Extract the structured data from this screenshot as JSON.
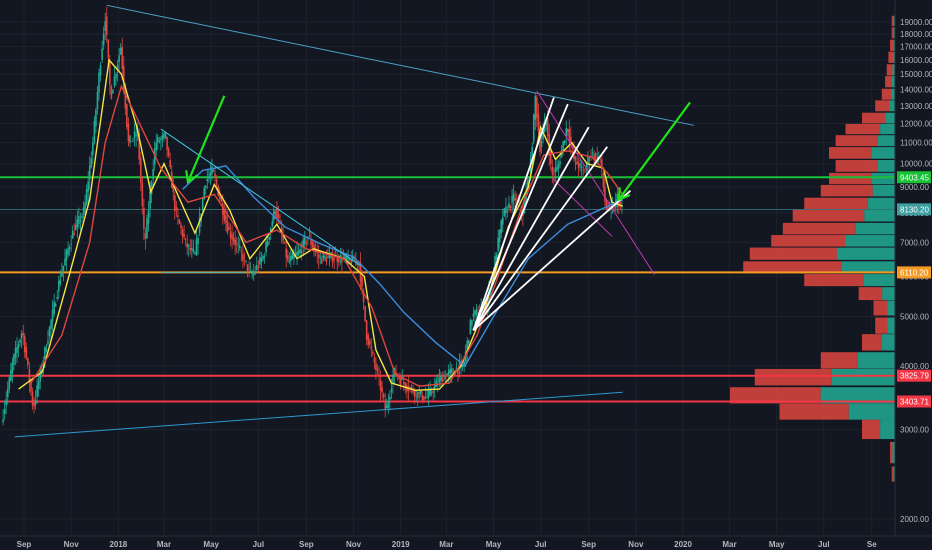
{
  "chart_data": {
    "type": "candlestick",
    "y_axis": {
      "scale": "log",
      "range": [
        1850,
        21000
      ],
      "ticks": [
        2000,
        3000,
        4000,
        5000,
        6000,
        7000,
        8000,
        9000,
        10000,
        11000,
        12000,
        13000,
        14000,
        15000,
        16000,
        17000,
        18000,
        19000
      ],
      "tick_labels": [
        "2000.00",
        "3000.00",
        "4000.00",
        "5000.00",
        "6000.00",
        "7000.00",
        "8000.00",
        "9000.00",
        "10000.00",
        "11000.00",
        "12000.00",
        "13000.00",
        "14000.00",
        "15000.00",
        "16000.00",
        "17000.00",
        "18000.00",
        "19000.00"
      ]
    },
    "x_axis": {
      "range": [
        "2017-08-01",
        "2020-10-01"
      ],
      "ticks": [
        {
          "date": "2017-09-01",
          "label": "Sep"
        },
        {
          "date": "2017-11-01",
          "label": "Nov"
        },
        {
          "date": "2018-01-01",
          "label": "2018"
        },
        {
          "date": "2018-03-01",
          "label": "Mar"
        },
        {
          "date": "2018-05-01",
          "label": "May"
        },
        {
          "date": "2018-07-01",
          "label": "Jul"
        },
        {
          "date": "2018-09-01",
          "label": "Sep"
        },
        {
          "date": "2018-11-01",
          "label": "Nov"
        },
        {
          "date": "2019-01-01",
          "label": "2019"
        },
        {
          "date": "2019-03-01",
          "label": "Mar"
        },
        {
          "date": "2019-05-01",
          "label": "May"
        },
        {
          "date": "2019-07-01",
          "label": "Jul"
        },
        {
          "date": "2019-09-01",
          "label": "Sep"
        },
        {
          "date": "2019-11-01",
          "label": "Nov"
        },
        {
          "date": "2020-01-01",
          "label": "2020"
        },
        {
          "date": "2020-03-01",
          "label": "Mar"
        },
        {
          "date": "2020-05-01",
          "label": "May"
        },
        {
          "date": "2020-07-01",
          "label": "Jul"
        },
        {
          "date": "2020-09-01",
          "label": "Se"
        }
      ]
    },
    "price_series": [
      [
        "2017-08-05",
        3100
      ],
      [
        "2017-08-20",
        4100
      ],
      [
        "2017-09-01",
        4700
      ],
      [
        "2017-09-15",
        3300
      ],
      [
        "2017-10-01",
        4350
      ],
      [
        "2017-10-20",
        6000
      ],
      [
        "2017-11-05",
        7300
      ],
      [
        "2017-11-20",
        8100
      ],
      [
        "2017-12-01",
        11000
      ],
      [
        "2017-12-10",
        15500
      ],
      [
        "2017-12-17",
        19500
      ],
      [
        "2017-12-24",
        13500
      ],
      [
        "2018-01-06",
        17000
      ],
      [
        "2018-01-16",
        11000
      ],
      [
        "2018-01-28",
        11500
      ],
      [
        "2018-02-06",
        6900
      ],
      [
        "2018-02-20",
        11000
      ],
      [
        "2018-03-05",
        11300
      ],
      [
        "2018-03-18",
        8000
      ],
      [
        "2018-04-01",
        6900
      ],
      [
        "2018-04-12",
        6600
      ],
      [
        "2018-04-25",
        9200
      ],
      [
        "2018-05-05",
        9700
      ],
      [
        "2018-05-25",
        7400
      ],
      [
        "2018-06-10",
        6700
      ],
      [
        "2018-06-24",
        6000
      ],
      [
        "2018-07-10",
        6600
      ],
      [
        "2018-07-25",
        8200
      ],
      [
        "2018-08-10",
        6400
      ],
      [
        "2018-08-25",
        6700
      ],
      [
        "2018-09-05",
        7200
      ],
      [
        "2018-09-20",
        6500
      ],
      [
        "2018-10-10",
        6550
      ],
      [
        "2018-11-10",
        6400
      ],
      [
        "2018-11-20",
        4600
      ],
      [
        "2018-12-05",
        3800
      ],
      [
        "2018-12-15",
        3250
      ],
      [
        "2018-12-25",
        3900
      ],
      [
        "2019-01-10",
        3650
      ],
      [
        "2019-02-05",
        3450
      ],
      [
        "2019-02-25",
        3800
      ],
      [
        "2019-03-25",
        4000
      ],
      [
        "2019-04-05",
        5000
      ],
      [
        "2019-04-25",
        5300
      ],
      [
        "2019-05-15",
        7900
      ],
      [
        "2019-05-30",
        8600
      ],
      [
        "2019-06-10",
        8000
      ],
      [
        "2019-06-20",
        10000
      ],
      [
        "2019-06-26",
        13500
      ],
      [
        "2019-07-02",
        10800
      ],
      [
        "2019-07-10",
        12300
      ],
      [
        "2019-07-17",
        9500
      ],
      [
        "2019-07-25",
        9800
      ],
      [
        "2019-08-06",
        11900
      ],
      [
        "2019-08-15",
        10200
      ],
      [
        "2019-08-28",
        9600
      ],
      [
        "2019-09-05",
        10500
      ],
      [
        "2019-09-18",
        10200
      ],
      [
        "2019-09-25",
        8200
      ],
      [
        "2019-10-05",
        8100
      ],
      [
        "2019-10-10",
        8600
      ],
      [
        "2019-10-15",
        8130
      ]
    ],
    "moving_averages": [
      {
        "color": "#f5e642",
        "points": [
          [
            "2017-08-25",
            3600
          ],
          [
            "2017-09-25",
            3900
          ],
          [
            "2017-10-25",
            5700
          ],
          [
            "2017-11-25",
            8500
          ],
          [
            "2017-12-05",
            11000
          ],
          [
            "2017-12-20",
            16000
          ],
          [
            "2018-01-05",
            15000
          ],
          [
            "2018-01-25",
            11800
          ],
          [
            "2018-02-12",
            8800
          ],
          [
            "2018-03-01",
            10000
          ],
          [
            "2018-03-20",
            8600
          ],
          [
            "2018-04-10",
            7300
          ],
          [
            "2018-05-05",
            9100
          ],
          [
            "2018-05-25",
            8100
          ],
          [
            "2018-06-20",
            6500
          ],
          [
            "2018-07-25",
            7600
          ],
          [
            "2018-08-20",
            6500
          ],
          [
            "2018-09-10",
            6800
          ],
          [
            "2018-10-20",
            6500
          ],
          [
            "2018-11-15",
            6000
          ],
          [
            "2018-11-30",
            4300
          ],
          [
            "2018-12-20",
            3700
          ],
          [
            "2019-01-20",
            3580
          ],
          [
            "2019-02-20",
            3600
          ],
          [
            "2019-03-20",
            4000
          ],
          [
            "2019-04-20",
            5200
          ],
          [
            "2019-05-20",
            7500
          ],
          [
            "2019-06-15",
            9000
          ],
          [
            "2019-07-01",
            11800
          ],
          [
            "2019-07-20",
            10200
          ],
          [
            "2019-08-10",
            11000
          ],
          [
            "2019-08-30",
            10000
          ],
          [
            "2019-09-20",
            9800
          ],
          [
            "2019-10-01",
            8400
          ],
          [
            "2019-10-15",
            8250
          ]
        ]
      },
      {
        "color": "#e0463f",
        "points": [
          [
            "2017-09-10",
            3700
          ],
          [
            "2017-10-20",
            4600
          ],
          [
            "2017-11-25",
            7000
          ],
          [
            "2017-12-15",
            11000
          ],
          [
            "2018-01-05",
            14200
          ],
          [
            "2018-01-25",
            12300
          ],
          [
            "2018-02-25",
            9800
          ],
          [
            "2018-04-01",
            8400
          ],
          [
            "2018-05-05",
            8700
          ],
          [
            "2018-06-15",
            7000
          ],
          [
            "2018-07-25",
            7400
          ],
          [
            "2018-09-01",
            6800
          ],
          [
            "2018-10-20",
            6500
          ],
          [
            "2018-11-25",
            5200
          ],
          [
            "2018-12-25",
            3850
          ],
          [
            "2019-01-25",
            3650
          ],
          [
            "2019-03-05",
            3700
          ],
          [
            "2019-04-10",
            4600
          ],
          [
            "2019-05-10",
            6200
          ],
          [
            "2019-06-10",
            8500
          ],
          [
            "2019-07-05",
            10400
          ],
          [
            "2019-08-05",
            10600
          ],
          [
            "2019-09-05",
            10300
          ],
          [
            "2019-09-25",
            9600
          ],
          [
            "2019-10-15",
            8700
          ]
        ]
      },
      {
        "color": "#3b8ddd",
        "points": [
          [
            "2018-03-25",
            8900
          ],
          [
            "2018-04-20",
            9700
          ],
          [
            "2018-05-20",
            9900
          ],
          [
            "2018-06-25",
            8600
          ],
          [
            "2018-08-05",
            7500
          ],
          [
            "2018-09-20",
            6950
          ],
          [
            "2018-11-01",
            6550
          ],
          [
            "2018-12-05",
            5800
          ],
          [
            "2019-01-05",
            5100
          ],
          [
            "2019-02-15",
            4450
          ],
          [
            "2019-03-25",
            4000
          ],
          [
            "2019-05-01",
            5000
          ],
          [
            "2019-06-15",
            6500
          ],
          [
            "2019-08-05",
            7600
          ],
          [
            "2019-10-15",
            8500
          ]
        ]
      }
    ],
    "horizontal_levels": [
      {
        "value": 9403.45,
        "label": "9403.45",
        "color": "#19c137"
      },
      {
        "value": 6110.2,
        "label": "6110.20",
        "color": "#f59a23"
      },
      {
        "value": 3825.79,
        "label": "3825.79",
        "color": "#f23645"
      },
      {
        "value": 3403.71,
        "label": "3403.71",
        "color": "#f23645"
      }
    ],
    "current_price": {
      "value": 8130.2,
      "label": "8130.20",
      "color": "#3e9ea0"
    },
    "trendlines": [
      {
        "color": "#4aa3c7",
        "from": [
          "2017-12-17",
          20500
        ],
        "to": [
          "2020-01-15",
          11900
        ]
      },
      {
        "color": "#2f97d0",
        "from": [
          "2017-08-20",
          2900
        ],
        "to": [
          "2019-10-15",
          3550
        ]
      },
      {
        "color": "#3fc6e0",
        "from": [
          "2018-02-25",
          11700
        ],
        "to": [
          "2018-11-10",
          6300
        ]
      },
      {
        "color": "#4fb3c0",
        "from": [
          "2018-02-25",
          6110
        ],
        "to": [
          "2018-06-15",
          6110
        ]
      },
      {
        "color": "#c13ab0",
        "from": [
          "2019-06-26",
          13900
        ],
        "to": [
          "2019-11-25",
          6050
        ]
      },
      {
        "color": "#c13ab0",
        "from": [
          "2019-07-15",
          9400
        ],
        "to": [
          "2019-10-01",
          7200
        ]
      },
      {
        "color": "#ffffff",
        "from": [
          "2019-04-05",
          4700
        ],
        "to": [
          "2019-08-05",
          13100
        ]
      },
      {
        "color": "#ffffff",
        "from": [
          "2019-04-05",
          4700
        ],
        "to": [
          "2019-09-01",
          11800
        ]
      },
      {
        "color": "#ffffff",
        "from": [
          "2019-04-05",
          4700
        ],
        "to": [
          "2019-09-25",
          10800
        ]
      },
      {
        "color": "#ffffff",
        "from": [
          "2019-04-05",
          4700
        ],
        "to": [
          "2019-10-25",
          8850
        ]
      },
      {
        "color": "#ffffff",
        "from": [
          "2019-04-05",
          4700
        ],
        "to": [
          "2019-07-18",
          13500
        ]
      }
    ],
    "arrows": [
      {
        "color": "#1fe21a",
        "from": [
          "2018-05-18",
          13600
        ],
        "to": [
          "2018-04-01",
          9200
        ]
      },
      {
        "color": "#1fe21a",
        "from": [
          "2020-01-10",
          13200
        ],
        "to": [
          "2019-10-10",
          8500
        ]
      }
    ],
    "volume_profile": {
      "bins": [
        {
          "price": 2450,
          "total": 0.02,
          "up": 0.5
        },
        {
          "price": 2700,
          "total": 0.03,
          "up": 0.5
        },
        {
          "price": 3000,
          "total": 0.2,
          "up": 0.45
        },
        {
          "price": 3250,
          "total": 0.7,
          "up": 0.4
        },
        {
          "price": 3500,
          "total": 1.0,
          "up": 0.45
        },
        {
          "price": 3800,
          "total": 0.85,
          "up": 0.45
        },
        {
          "price": 4100,
          "total": 0.45,
          "up": 0.5
        },
        {
          "price": 4450,
          "total": 0.2,
          "up": 0.4
        },
        {
          "price": 4800,
          "total": 0.12,
          "up": 0.4
        },
        {
          "price": 5200,
          "total": 0.13,
          "up": 0.35
        },
        {
          "price": 5550,
          "total": 0.22,
          "up": 0.35
        },
        {
          "price": 5900,
          "total": 0.55,
          "up": 0.35
        },
        {
          "price": 6250,
          "total": 0.92,
          "up": 0.35
        },
        {
          "price": 6650,
          "total": 0.88,
          "up": 0.4
        },
        {
          "price": 7050,
          "total": 0.75,
          "up": 0.4
        },
        {
          "price": 7450,
          "total": 0.68,
          "up": 0.35
        },
        {
          "price": 7900,
          "total": 0.62,
          "up": 0.3
        },
        {
          "price": 8350,
          "total": 0.55,
          "up": 0.3
        },
        {
          "price": 8850,
          "total": 0.45,
          "up": 0.3
        },
        {
          "price": 9350,
          "total": 0.4,
          "up": 0.35
        },
        {
          "price": 9900,
          "total": 0.36,
          "up": 0.3
        },
        {
          "price": 10500,
          "total": 0.4,
          "up": 0.35
        },
        {
          "price": 11100,
          "total": 0.36,
          "up": 0.3
        },
        {
          "price": 11700,
          "total": 0.3,
          "up": 0.3
        },
        {
          "price": 12300,
          "total": 0.2,
          "up": 0.3
        },
        {
          "price": 13000,
          "total": 0.12,
          "up": 0.3
        },
        {
          "price": 13700,
          "total": 0.08,
          "up": 0.3
        },
        {
          "price": 14500,
          "total": 0.06,
          "up": 0.3
        },
        {
          "price": 15300,
          "total": 0.05,
          "up": 0.3
        },
        {
          "price": 16200,
          "total": 0.04,
          "up": 0.3
        },
        {
          "price": 17100,
          "total": 0.03,
          "up": 0.3
        },
        {
          "price": 18100,
          "total": 0.02,
          "up": 0.3
        },
        {
          "price": 19100,
          "total": 0.02,
          "up": 0.3
        }
      ],
      "up_color": "#22ab94",
      "down_color": "#e0463f"
    }
  }
}
